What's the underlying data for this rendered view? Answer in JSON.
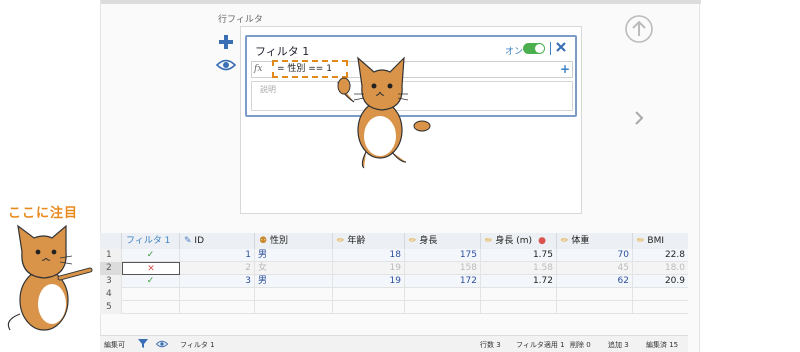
{
  "filter_section": {
    "label": "行フィルタ"
  },
  "filter": {
    "title": "フィルタ 1",
    "on_label": "オン",
    "fx_label": "fx",
    "formula": "= 性別  == 1",
    "description_placeholder": "説明"
  },
  "callout": {
    "text": "ここに注目"
  },
  "table": {
    "headers": [
      "フィルタ 1",
      "ID",
      "性別",
      "年齢",
      "身長",
      "身長 (m)",
      "体重",
      "BMI"
    ],
    "rows": [
      {
        "num": "1",
        "filter": "✓",
        "id": "1",
        "sex": "男",
        "age": "18",
        "height": "175",
        "height_m": "1.75",
        "weight": "70",
        "bmi": "22.8"
      },
      {
        "num": "2",
        "filter": "✕",
        "id": "2",
        "sex": "女",
        "age": "19",
        "height": "158",
        "height_m": "1.58",
        "weight": "45",
        "bmi": "18.0"
      },
      {
        "num": "3",
        "filter": "✓",
        "id": "3",
        "sex": "男",
        "age": "19",
        "height": "172",
        "height_m": "1.72",
        "weight": "62",
        "bmi": "20.9"
      },
      {
        "num": "4"
      },
      {
        "num": "5"
      }
    ]
  },
  "status": {
    "mode": "編集可",
    "filter_name": "フィルタ 1",
    "rows": "行数 3",
    "filter_applied": "フィルタ適用 1",
    "deleted": "削除 0",
    "added": "追加 3",
    "edited": "編集済 15"
  },
  "colors": {
    "accent": "#3b82c4",
    "toggle_on": "#4caf50",
    "highlight": "#e08a1e",
    "excluded": "#d9534f"
  }
}
